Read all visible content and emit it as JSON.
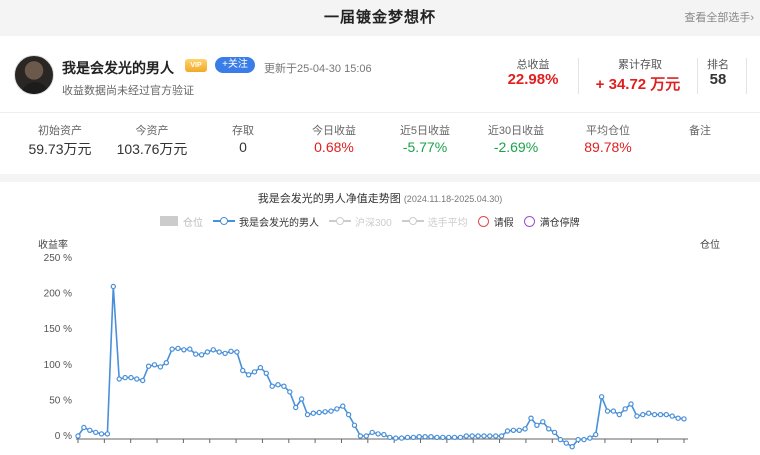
{
  "page": {
    "title": "一届镀金梦想杯",
    "view_all": "查看全部选手›"
  },
  "profile": {
    "name": "我是会发光的男人",
    "vip": "VIP",
    "follow": "+关注",
    "updated": "更新于25-04-30 15:06",
    "note": "收益数据尚未经过官方验证"
  },
  "summary": [
    {
      "label": "总收益",
      "value": "22.98%",
      "color": "#e02020"
    },
    {
      "label": "累计存取",
      "value": "+ 34.72 万元",
      "color": "#e02020"
    },
    {
      "label": "排名",
      "value": "58",
      "color": "#333333"
    }
  ],
  "metrics": [
    {
      "label": "初始资产",
      "value": "59.73万元",
      "color": "#333333"
    },
    {
      "label": "今资产",
      "value": "103.76万元",
      "color": "#333333"
    },
    {
      "label": "存取",
      "value": "0",
      "color": "#333333"
    },
    {
      "label": "今日收益",
      "value": "0.68%",
      "color": "#e02020"
    },
    {
      "label": "近5日收益",
      "value": "-5.77%",
      "color": "#1aa34a"
    },
    {
      "label": "近30日收益",
      "value": "-2.69%",
      "color": "#1aa34a"
    },
    {
      "label": "平均仓位",
      "value": "89.78%",
      "color": "#e02020"
    },
    {
      "label": "备注",
      "value": "",
      "color": "#333333"
    }
  ],
  "chart": {
    "title": "我是会发光的男人净值走势图",
    "range": "(2024.11.18-2025.04.30)",
    "y_left_label": "收益率",
    "y_right_label": "仓位",
    "legend": [
      {
        "label": "仓位",
        "kind": "rect",
        "color": "#cccccc",
        "active": false
      },
      {
        "label": "我是会发光的男人",
        "kind": "line",
        "color": "#4a90d9",
        "active": true
      },
      {
        "label": "沪深300",
        "kind": "line",
        "color": "#cccccc",
        "active": false
      },
      {
        "label": "选手平均",
        "kind": "line",
        "color": "#cccccc",
        "active": false
      },
      {
        "label": "请假",
        "kind": "circle",
        "color": "#e04a4a",
        "active": true
      },
      {
        "label": "满仓停牌",
        "kind": "circle",
        "color": "#9b4fd0",
        "active": true
      }
    ]
  },
  "chart_data": {
    "type": "line",
    "title": "我是会发光的男人净值走势图",
    "ylabel": "收益率",
    "y2label": "仓位",
    "ylim": [
      0,
      250
    ],
    "yticks": [
      "0 %",
      "50 %",
      "100 %",
      "150 %",
      "200 %",
      "250 %"
    ],
    "grid": false,
    "legend_position": "top",
    "series": [
      {
        "name": "我是会发光的男人",
        "color": "#4a90d9",
        "values": [
          0,
          12,
          8,
          5,
          3,
          3,
          210,
          80,
          82,
          82,
          80,
          78,
          98,
          100,
          97,
          103,
          122,
          123,
          121,
          122,
          115,
          114,
          118,
          121,
          118,
          116,
          119,
          118,
          92,
          86,
          90,
          96,
          88,
          70,
          72,
          70,
          62,
          40,
          52,
          30,
          32,
          33,
          34,
          35,
          38,
          42,
          30,
          15,
          0,
          0,
          5,
          3,
          2,
          -2,
          -3,
          -3,
          -2,
          -2,
          -1,
          -1,
          -1,
          -2,
          -2,
          -2,
          -2,
          -2,
          0,
          0,
          0,
          0,
          0,
          0,
          0,
          7,
          8,
          8,
          10,
          25,
          15,
          20,
          10,
          5,
          -5,
          -10,
          -15,
          -5,
          -5,
          -3,
          2,
          55,
          35,
          35,
          30,
          38,
          45,
          28,
          30,
          32,
          30,
          30,
          30,
          28,
          25,
          24
        ]
      }
    ]
  }
}
